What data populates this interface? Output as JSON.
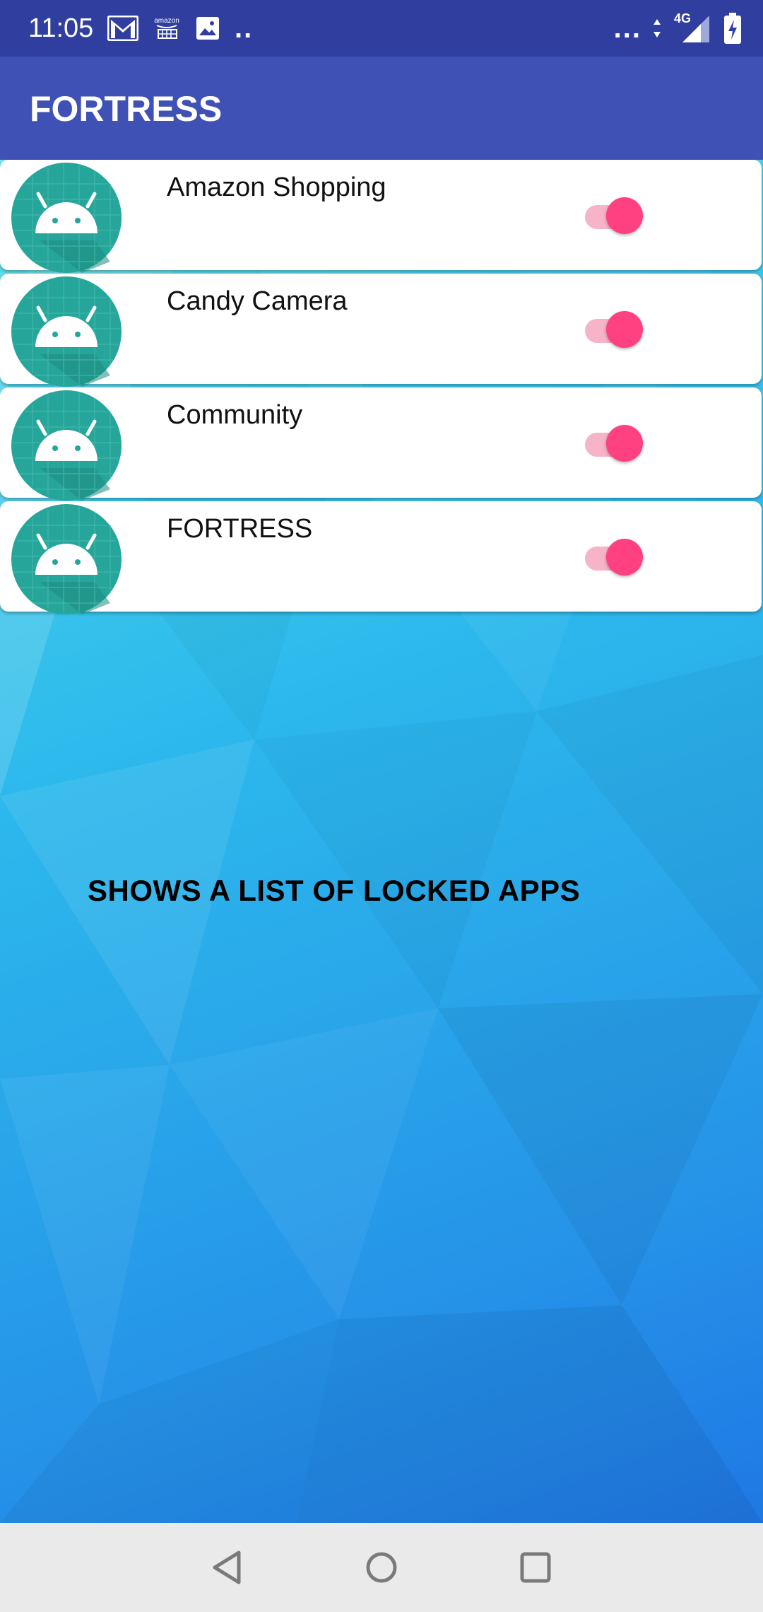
{
  "status_bar": {
    "time": "11:05",
    "overflow_dots": "..",
    "more_dots": "...",
    "network": "4G",
    "left_icons": [
      "gmail-icon",
      "amazon-icon",
      "image-icon"
    ],
    "right_icons": [
      "data-arrows-icon",
      "signal-icon",
      "battery-charging-icon"
    ]
  },
  "app_bar": {
    "title": "FORTRESS"
  },
  "apps": [
    {
      "name": "Amazon Shopping",
      "locked": true
    },
    {
      "name": "Candy Camera",
      "locked": true
    },
    {
      "name": "Community",
      "locked": true
    },
    {
      "name": "FORTRESS",
      "locked": true
    }
  ],
  "caption": "SHOWS A LIST OF LOCKED APPS",
  "nav": {
    "buttons": [
      "back",
      "home",
      "recents"
    ]
  },
  "colors": {
    "status_bar": "#303f9f",
    "app_bar": "#3f51b5",
    "toggle_thumb": "#ff4081",
    "toggle_track": "#f7b3c8",
    "android_icon_bg": "#26a69a"
  }
}
